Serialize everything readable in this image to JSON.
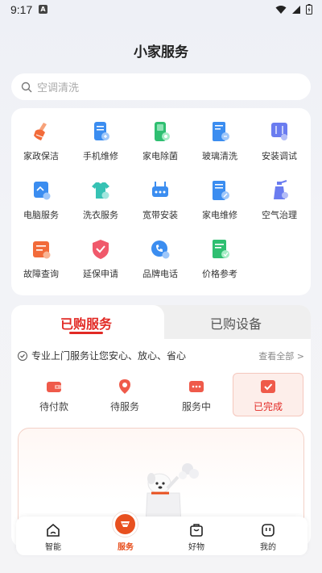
{
  "status_bar": {
    "time": "9:17",
    "notification_icon": "a-badge-icon"
  },
  "header": {
    "title": "小家服务"
  },
  "search": {
    "placeholder": "空调清洗"
  },
  "services": [
    {
      "label": "家政保洁",
      "icon": "broom-icon",
      "color": "#f26b3a"
    },
    {
      "label": "手机维修",
      "icon": "phone-repair-icon",
      "color": "#3b8df0"
    },
    {
      "label": "家电除菌",
      "icon": "appliance-disinfect-icon",
      "color": "#2fbf71"
    },
    {
      "label": "玻璃清洗",
      "icon": "glass-clean-icon",
      "color": "#3b8df0"
    },
    {
      "label": "安装调试",
      "icon": "install-debug-icon",
      "color": "#6a7cf0"
    },
    {
      "label": "电脑服务",
      "icon": "computer-service-icon",
      "color": "#3b8df0"
    },
    {
      "label": "洗衣服务",
      "icon": "laundry-icon",
      "color": "#36c2b4"
    },
    {
      "label": "宽带安装",
      "icon": "broadband-icon",
      "color": "#3b8df0"
    },
    {
      "label": "家电维修",
      "icon": "appliance-repair-icon",
      "color": "#3b8df0"
    },
    {
      "label": "空气治理",
      "icon": "air-spray-icon",
      "color": "#6a7cf0"
    },
    {
      "label": "故障查询",
      "icon": "fault-query-icon",
      "color": "#f26b3a"
    },
    {
      "label": "延保申请",
      "icon": "extended-warranty-icon",
      "color": "#f0596b"
    },
    {
      "label": "品牌电话",
      "icon": "brand-phone-icon",
      "color": "#3b8df0"
    },
    {
      "label": "价格参考",
      "icon": "price-reference-icon",
      "color": "#2fbf71"
    }
  ],
  "orders": {
    "tabs": [
      {
        "label": "已购服务",
        "active": true
      },
      {
        "label": "已购设备",
        "active": false
      }
    ],
    "promise": "专业上门服务让您安心、放心、省心",
    "view_all": "查看全部 >",
    "statuses": [
      {
        "label": "待付款",
        "icon": "wallet-icon"
      },
      {
        "label": "待服务",
        "icon": "location-pin-icon"
      },
      {
        "label": "服务中",
        "icon": "in-progress-icon"
      },
      {
        "label": "已完成",
        "icon": "completed-check-icon",
        "selected": true
      }
    ]
  },
  "bottom_nav": [
    {
      "label": "智能",
      "icon": "smart-home-icon"
    },
    {
      "label": "服务",
      "icon": "service-icon",
      "active": true
    },
    {
      "label": "好物",
      "icon": "shopping-bag-icon"
    },
    {
      "label": "我的",
      "icon": "profile-face-icon"
    }
  ],
  "colors": {
    "accent": "#e22a25",
    "nav_active": "#e8501f"
  }
}
